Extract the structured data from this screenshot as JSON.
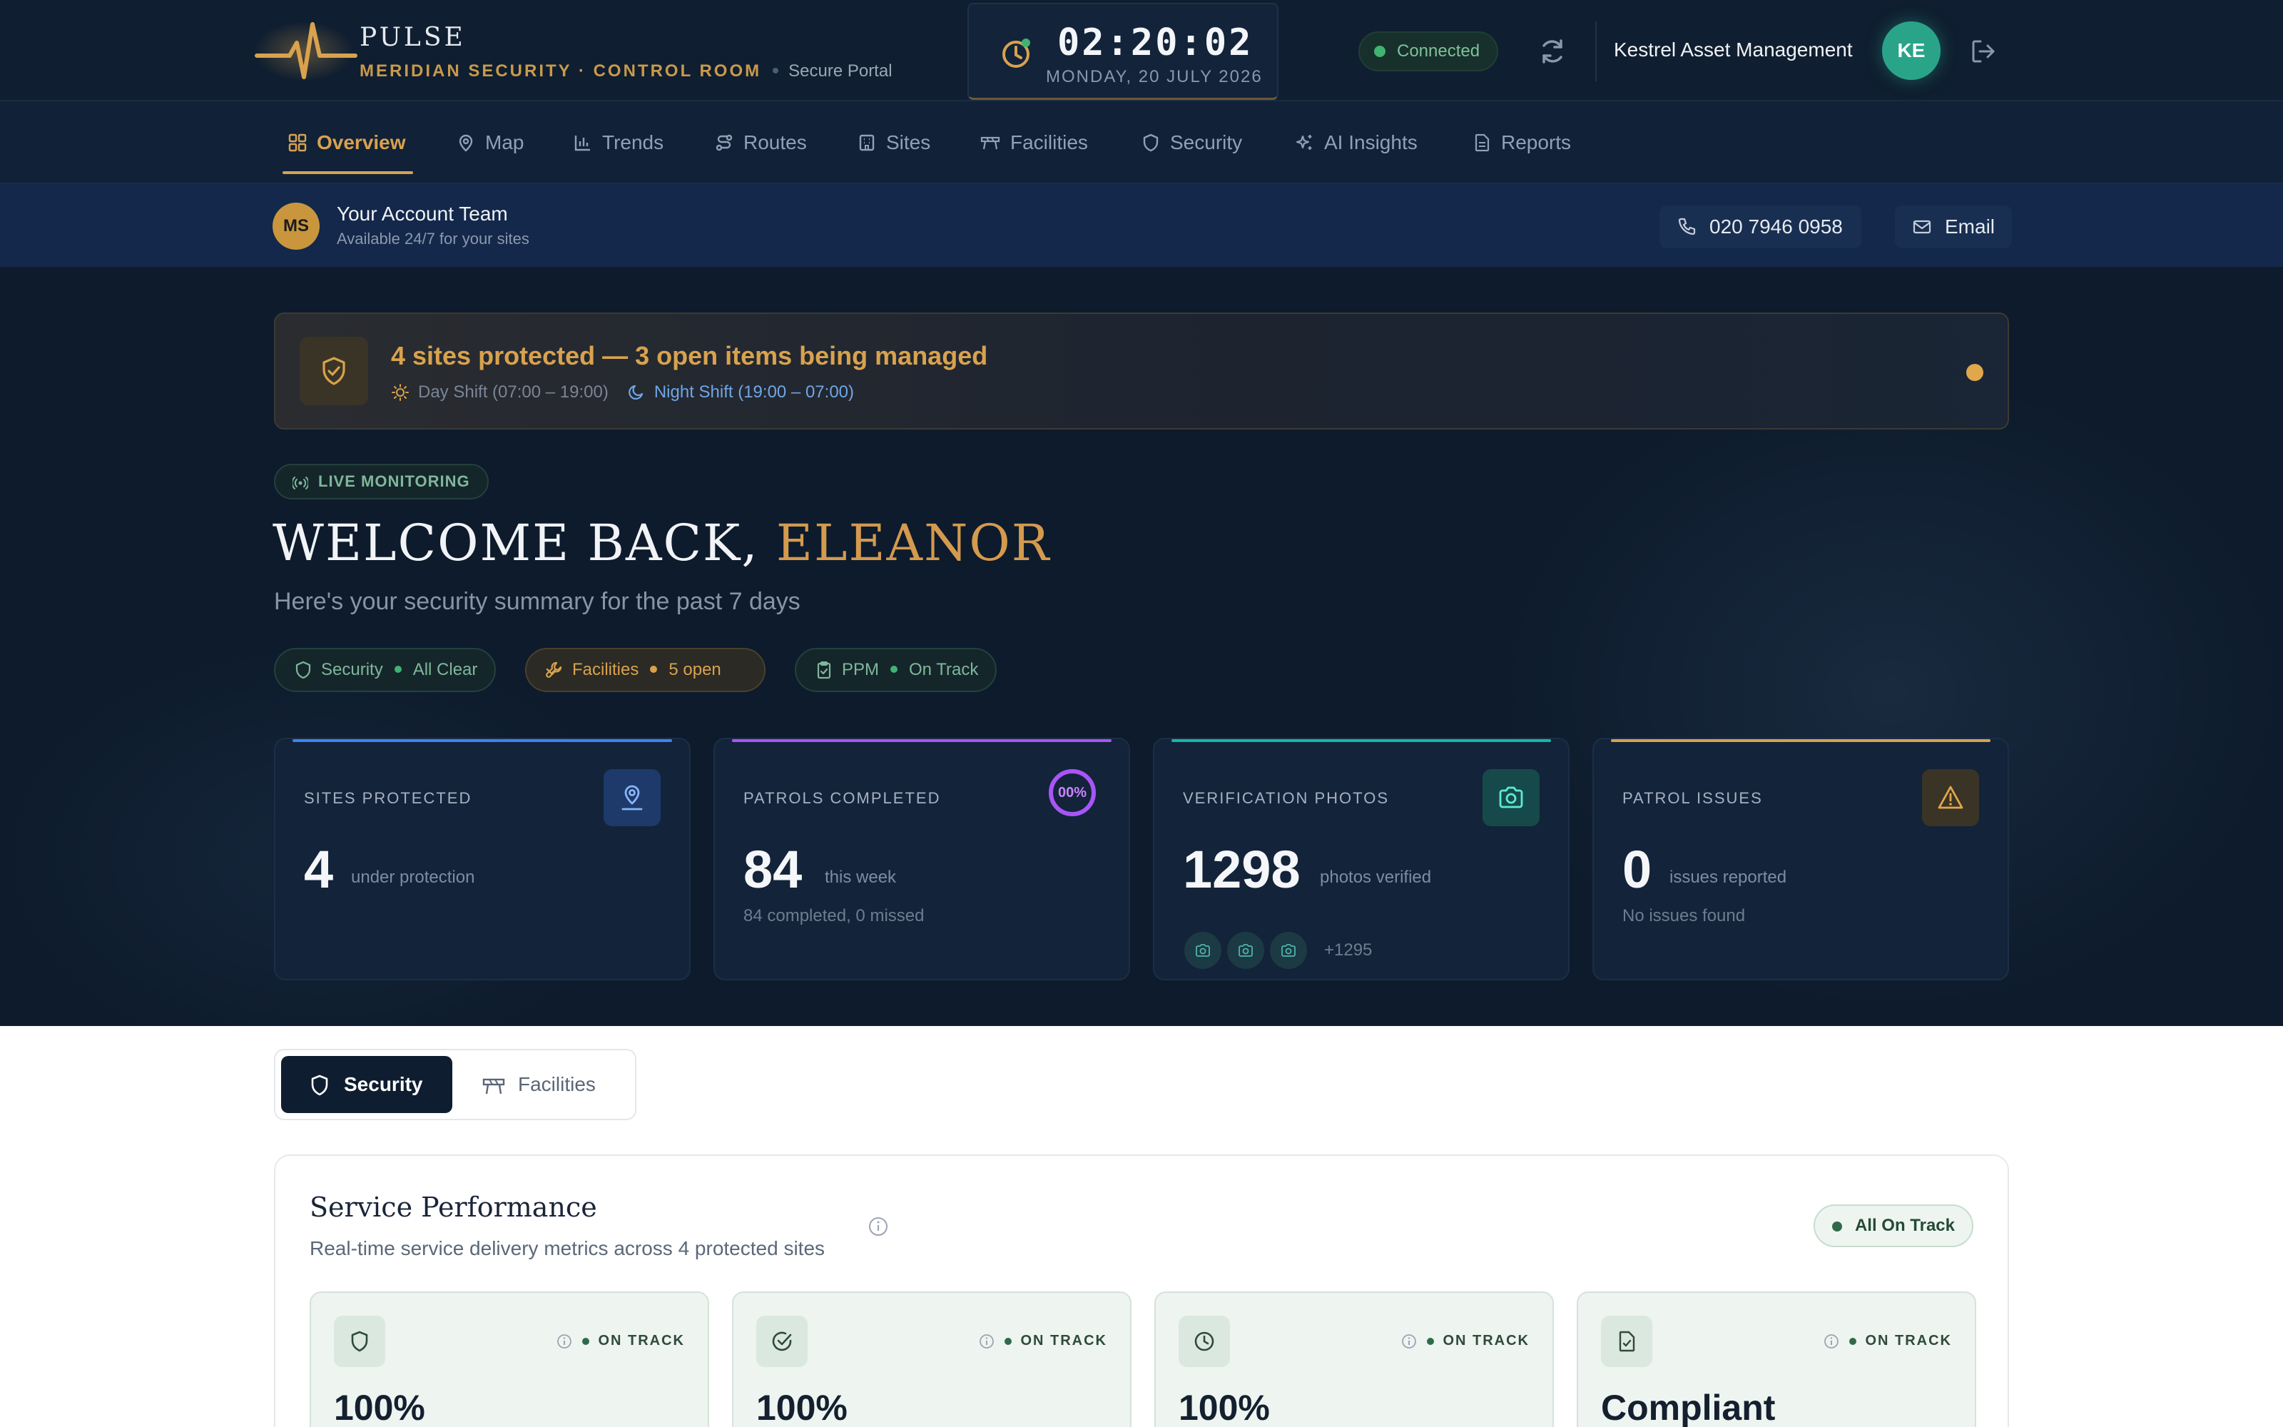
{
  "header": {
    "brand": "PULSE",
    "company": "MERIDIAN SECURITY · CONTROL ROOM",
    "portal": "Secure Portal",
    "time": "02:20:02",
    "date": "MONDAY, 20 JULY 2026",
    "connection": "Connected",
    "client": "Kestrel Asset Management",
    "avatar_initials": "KE"
  },
  "nav": {
    "items": [
      {
        "label": "Overview",
        "icon": "grid-icon",
        "active": true
      },
      {
        "label": "Map",
        "icon": "map-pin-icon"
      },
      {
        "label": "Trends",
        "icon": "bar-chart-icon"
      },
      {
        "label": "Routes",
        "icon": "route-icon"
      },
      {
        "label": "Sites",
        "icon": "building-icon"
      },
      {
        "label": "Facilities",
        "icon": "wrench-icon"
      },
      {
        "label": "Security",
        "icon": "shield-icon"
      },
      {
        "label": "AI Insights",
        "icon": "sparkles-icon"
      },
      {
        "label": "Reports",
        "icon": "document-icon"
      }
    ]
  },
  "account": {
    "initials": "MS",
    "title": "Your Account Team",
    "subtitle": "Available 24/7 for your sites",
    "phone": "020 7946 0958",
    "email_label": "Email"
  },
  "banner": {
    "title": "4 sites protected — 3 open items being managed",
    "day_shift": "Day Shift (07:00 – 19:00)",
    "night_shift": "Night Shift (19:00 – 07:00)"
  },
  "welcome": {
    "live": "LIVE MONITORING",
    "greeting": "WELCOME BACK,",
    "name": "ELEANOR",
    "summary": "Here's your security summary for the past 7 days"
  },
  "chips": {
    "security": {
      "label": "Security",
      "status": "All Clear"
    },
    "facilities": {
      "label": "Facilities",
      "status": "5 open"
    },
    "ppm": {
      "label": "PPM",
      "status": "On Track"
    }
  },
  "stats": [
    {
      "label": "SITES PROTECTED",
      "value": "4",
      "unit": "under protection",
      "note": "",
      "accent": "#3b82f6"
    },
    {
      "label": "PATROLS COMPLETED",
      "value": "84",
      "unit": "this week",
      "note": "84 completed, 0 missed",
      "ring": "00%",
      "progress": 1.0,
      "accent": "#a855f7"
    },
    {
      "label": "VERIFICATION PHOTOS",
      "value": "1298",
      "unit": "photos verified",
      "note": "",
      "more": "+1295",
      "accent": "#14b8a6"
    },
    {
      "label": "PATROL ISSUES",
      "value": "0",
      "unit": "issues reported",
      "note": "No issues found",
      "accent": "#d8a24e"
    }
  ],
  "tabs": {
    "security": "Security",
    "facilities": "Facilities"
  },
  "performance": {
    "title": "Service Performance",
    "subtitle": "Real-time service delivery metrics across 4 protected sites",
    "badge": "All On Track",
    "metrics": [
      {
        "icon": "shield-icon",
        "status": "ON TRACK",
        "value": "100%"
      },
      {
        "icon": "check-circle-icon",
        "status": "ON TRACK",
        "value": "100%"
      },
      {
        "icon": "clock-icon",
        "status": "ON TRACK",
        "value": "100%"
      },
      {
        "icon": "document-check-icon",
        "status": "ON TRACK",
        "value": "Compliant"
      }
    ]
  }
}
